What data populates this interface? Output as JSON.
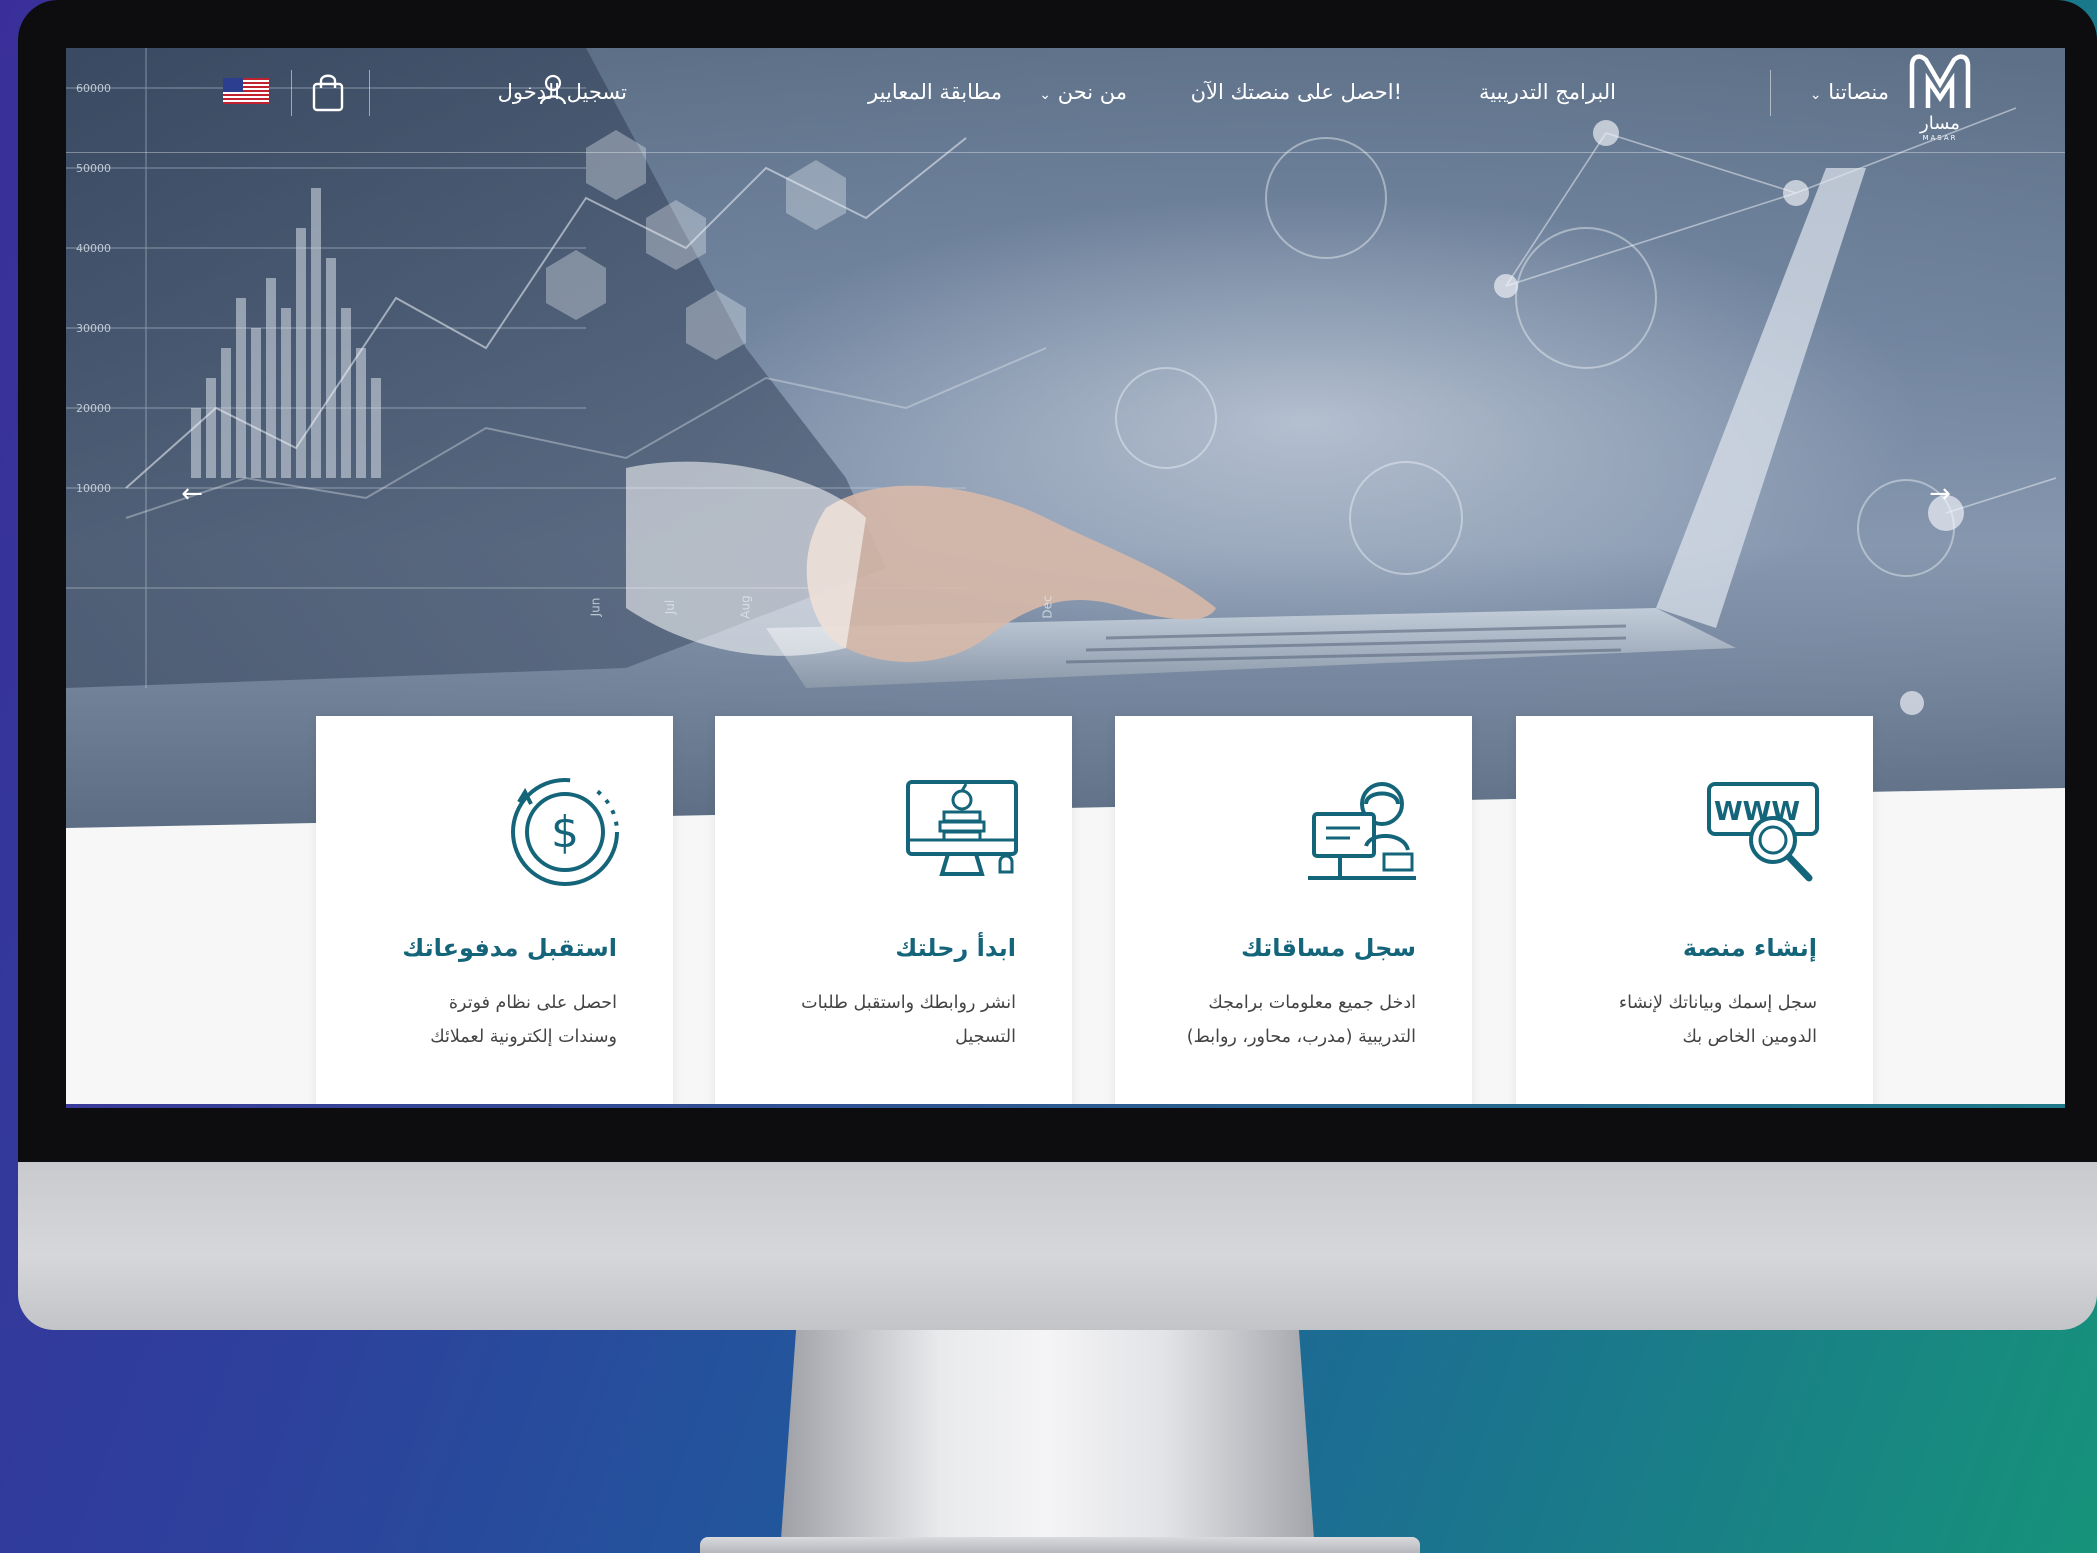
{
  "nav": {
    "logo_text": "مسار",
    "logo_subtext": "MASAR",
    "items": [
      {
        "label": "منصاتنا",
        "has_dropdown": true
      },
      {
        "label": "البرامج التدريبية",
        "has_dropdown": false
      },
      {
        "label": "احصل على منصتك الآن!",
        "has_dropdown": false
      },
      {
        "label": "من نحن",
        "has_dropdown": true
      },
      {
        "label": "مطابقة المعايير",
        "has_dropdown": false
      }
    ],
    "login_label": "تسجيل الدخول",
    "cart_icon": "shopping-bag-icon",
    "language_icon": "us-flag-icon"
  },
  "hero": {
    "prev_icon": "arrow-left-icon",
    "next_icon": "arrow-right-icon",
    "chart_ticks": [
      "60000",
      "50000",
      "40000",
      "30000",
      "20000",
      "10000"
    ],
    "month_labels": [
      "Jun",
      "Jul",
      "Aug",
      "Dec"
    ]
  },
  "cards": [
    {
      "icon": "www-search-icon",
      "title": "إنشاء منصة",
      "desc_line1": "سجل إسمك وبياناتك لإنشاء",
      "desc_line2": "الدومين الخاص بك"
    },
    {
      "icon": "trainer-computer-icon",
      "title": "سجل مساقاتك",
      "desc_line1": "ادخل جميع معلومات برامجك",
      "desc_line2": "التدريبية (مدرب، محاور، روابط)"
    },
    {
      "icon": "monitor-books-icon",
      "title": "ابدأ رحلتك",
      "desc_line1": "انشر روابطك واستقبل طلبات",
      "desc_line2": "التسجيل"
    },
    {
      "icon": "dollar-cycle-icon",
      "title": "استقبل مدفوعاتك",
      "desc_line1": "احصل على نظام فوترة",
      "desc_line2": "وسندات إلكترونية لعملائك"
    }
  ],
  "colors": {
    "accent": "#15657a",
    "background_gradient_start": "#3a2f9a",
    "background_gradient_end": "#16937a"
  }
}
